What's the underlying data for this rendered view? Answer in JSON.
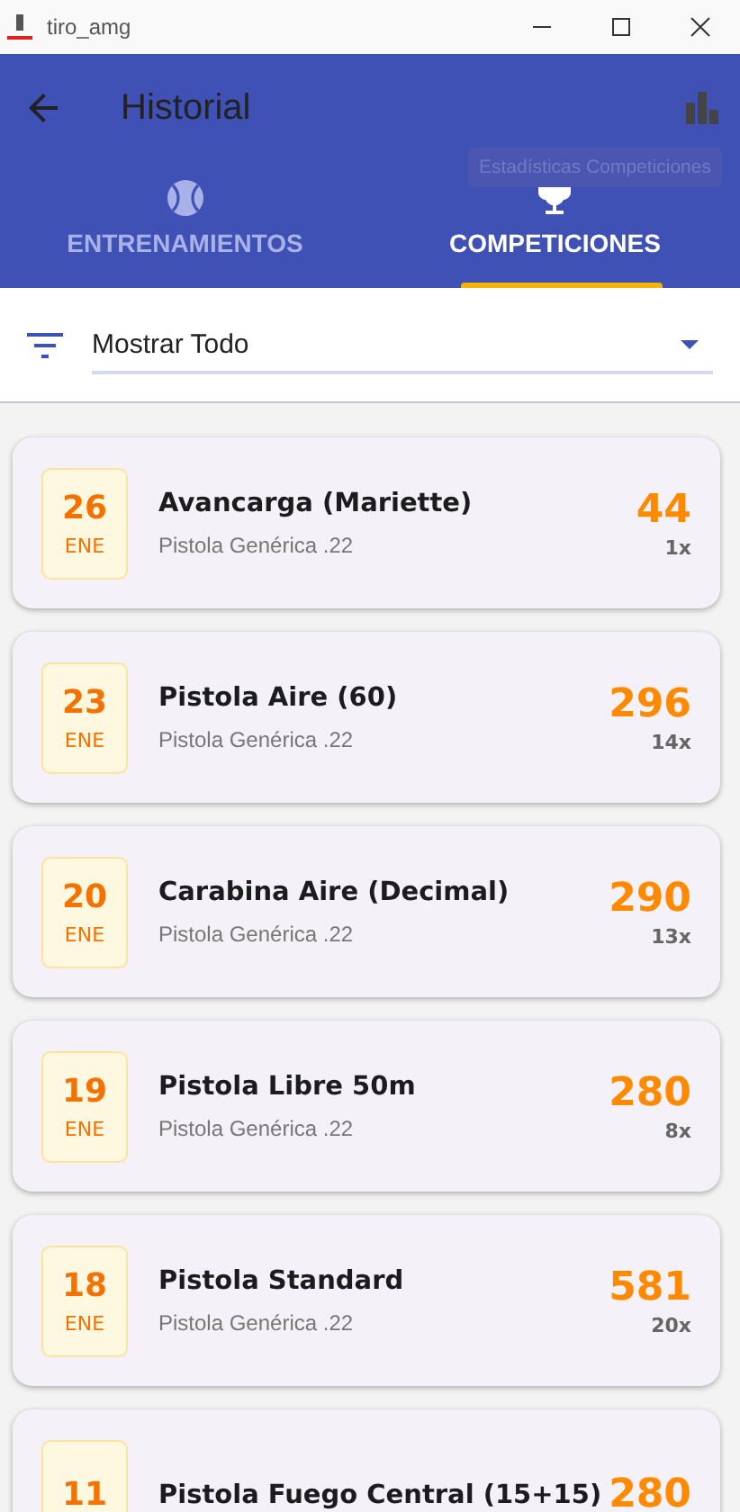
{
  "window": {
    "title": "tiro_amg"
  },
  "app_bar": {
    "title": "Historial",
    "tooltip": "Estadísticas Competiciones"
  },
  "tabs": [
    {
      "label": "ENTRENAMIENTOS",
      "selected": false
    },
    {
      "label": "COMPETICIONES",
      "selected": true
    }
  ],
  "filter": {
    "value": "Mostrar Todo"
  },
  "entries": [
    {
      "day": "26",
      "month": "ENE",
      "title": "Avancarga (Mariette)",
      "subtitle": "Pistola Genérica .22",
      "score": "44",
      "count": "1x"
    },
    {
      "day": "23",
      "month": "ENE",
      "title": "Pistola Aire (60)",
      "subtitle": "Pistola Genérica .22",
      "score": "296",
      "count": "14x"
    },
    {
      "day": "20",
      "month": "ENE",
      "title": "Carabina Aire (Decimal)",
      "subtitle": "Pistola Genérica .22",
      "score": "290",
      "count": "13x"
    },
    {
      "day": "19",
      "month": "ENE",
      "title": "Pistola Libre 50m",
      "subtitle": "Pistola Genérica .22",
      "score": "280",
      "count": "8x"
    },
    {
      "day": "18",
      "month": "ENE",
      "title": "Pistola Standard",
      "subtitle": "Pistola Genérica .22",
      "score": "581",
      "count": "20x"
    },
    {
      "day": "11",
      "title": "Pistola Fuego Central (15+15)",
      "score": "280"
    }
  ]
}
